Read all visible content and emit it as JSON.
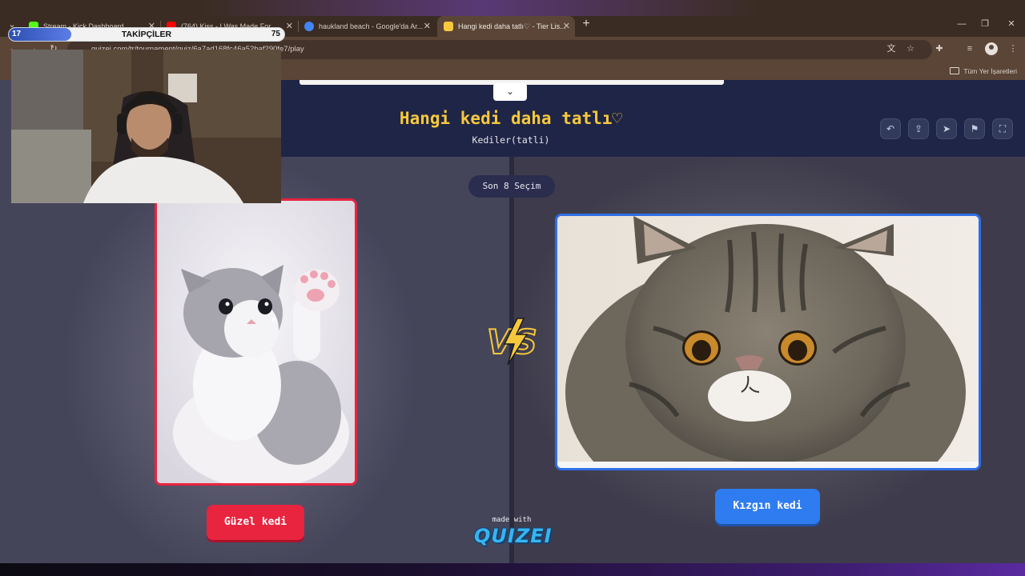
{
  "browser": {
    "tabs": [
      {
        "title": "Stream - Kick Dashboard",
        "favicon_color": "#53fc18"
      },
      {
        "title": "(764) Kiss - I Was Made For...",
        "favicon_color": "#ff0000"
      },
      {
        "title": "haukland beach - Google'da Ar...",
        "favicon_color": "#4285f4"
      },
      {
        "title": "Hangi kedi daha tatlı♡ - Tier Lis...",
        "favicon_color": "#f6c83c"
      }
    ],
    "active_tab_index": 3,
    "url": "quizei.com/tr/tournament/quiz/6a7ad168fc46a52baf290fe7/play",
    "bookmarks_folder": "Tüm Yer İşaretleri"
  },
  "stream_overlay": {
    "followers_label": "TAKİPÇİLER",
    "followers_current": "17",
    "followers_goal": "75",
    "progress": 0.227
  },
  "quiz": {
    "title": "Hangi kedi daha tatlı♡",
    "subtitle": "Kediler(tatli)",
    "round_label": "Son 8 Seçim",
    "left_choice": {
      "label": "Güzel kedi",
      "accent": "#e8243f"
    },
    "right_choice": {
      "label": "Kızgın kedi",
      "accent": "#2f7cf0"
    },
    "made_with": "made with",
    "brand": "QUIZEI",
    "vs_label": "VS"
  },
  "icons": {
    "header_actions": [
      "undo-icon",
      "share-icon",
      "send-icon",
      "flag-icon",
      "fullscreen-icon"
    ]
  }
}
